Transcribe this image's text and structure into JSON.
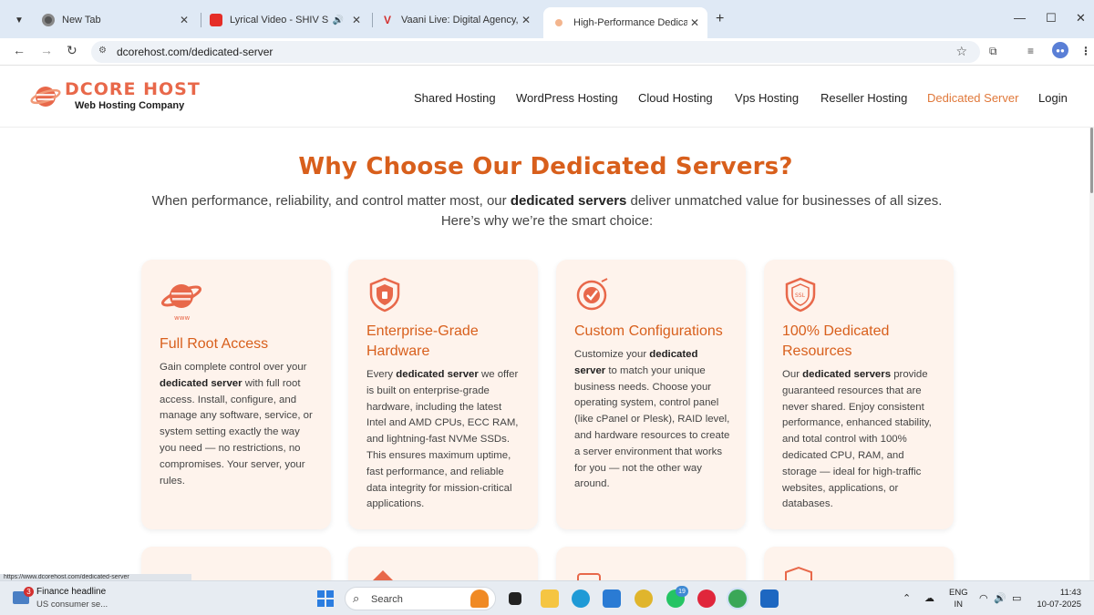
{
  "browser": {
    "tabs": [
      {
        "title": "New Tab",
        "favicon": "chrome-icon",
        "active": false
      },
      {
        "title": "Lyrical Video - SHIV SE GOR",
        "favicon": "youtube-icon",
        "active": false,
        "audio": true
      },
      {
        "title": "Vaani Live: Digital Agency, Web",
        "favicon": "vaani-icon",
        "active": false
      },
      {
        "title": "High-Performance Dedicated S",
        "favicon": "dcore-icon",
        "active": true
      }
    ],
    "url": "dcorehost.com/dedicated-server"
  },
  "site": {
    "logo_name": "DCORE HOST",
    "logo_tagline": "Web Hosting Company",
    "nav": [
      {
        "label": "Shared Hosting",
        "active": false
      },
      {
        "label": "WordPress Hosting",
        "active": false
      },
      {
        "label": "Cloud Hosting",
        "active": false
      },
      {
        "label": "Vps Hosting",
        "active": false
      },
      {
        "label": "Reseller Hosting",
        "active": false
      },
      {
        "label": "Dedicated Server",
        "active": true
      },
      {
        "label": "Login",
        "active": false
      }
    ],
    "accent_color": "#d85f1c",
    "nav_active_color": "#e0783a"
  },
  "hero": {
    "title": "Why Choose Our Dedicated Servers?",
    "subtitle_pre": "When performance, reliability, and control matter most, our ",
    "subtitle_bold": "dedicated servers",
    "subtitle_post": " deliver unmatched value for businesses of all sizes. Here’s why we’re the smart choice:"
  },
  "cards": [
    {
      "icon": "www-globe-icon",
      "title": "Full Root Access",
      "body_pre": "Gain complete control over your ",
      "body_bold": "dedicated server",
      "body_post": " with full root access. Install, configure, and manage any software, service, or system setting exactly the way you need — no restrictions, no compromises. Your server, your rules."
    },
    {
      "icon": "shield-icon",
      "title": "Enterprise-Grade Hardware",
      "body_pre": "Every ",
      "body_bold": "dedicated server",
      "body_post": " we offer is built on enterprise-grade hardware, including the latest Intel and AMD CPUs, ECC RAM, and lightning-fast NVMe SSDs. This ensures maximum uptime, fast performance, and reliable data integrity for mission-critical applications."
    },
    {
      "icon": "custom-check-icon",
      "title": "Custom Configurations",
      "body_pre": "Customize your ",
      "body_bold": "dedicated server",
      "body_post": " to match your unique business needs. Choose your operating system, control panel (like cPanel or Plesk), RAID level, and hardware resources to create a server environment that works for you — not the other way around."
    },
    {
      "icon": "ssl-shield-icon",
      "title": "100% Dedicated Resources",
      "body_pre": "Our ",
      "body_bold": "dedicated servers",
      "body_post": " provide guaranteed resources that are never shared. Enjoy consistent performance, enhanced stability, and total control with 100% dedicated CPU, RAM, and storage — ideal for high-traffic websites, applications, or databases."
    }
  ],
  "status_url": "https://www.dcorehost.com/dedicated-server",
  "taskbar": {
    "weather_title": "Finance headline",
    "weather_sub": "US consumer se...",
    "weather_badge": "3",
    "search_label": "Search",
    "whatsapp_badge": "19",
    "lang_line1": "ENG",
    "lang_line2": "IN",
    "time": "11:43",
    "date": "10-07-2025"
  }
}
